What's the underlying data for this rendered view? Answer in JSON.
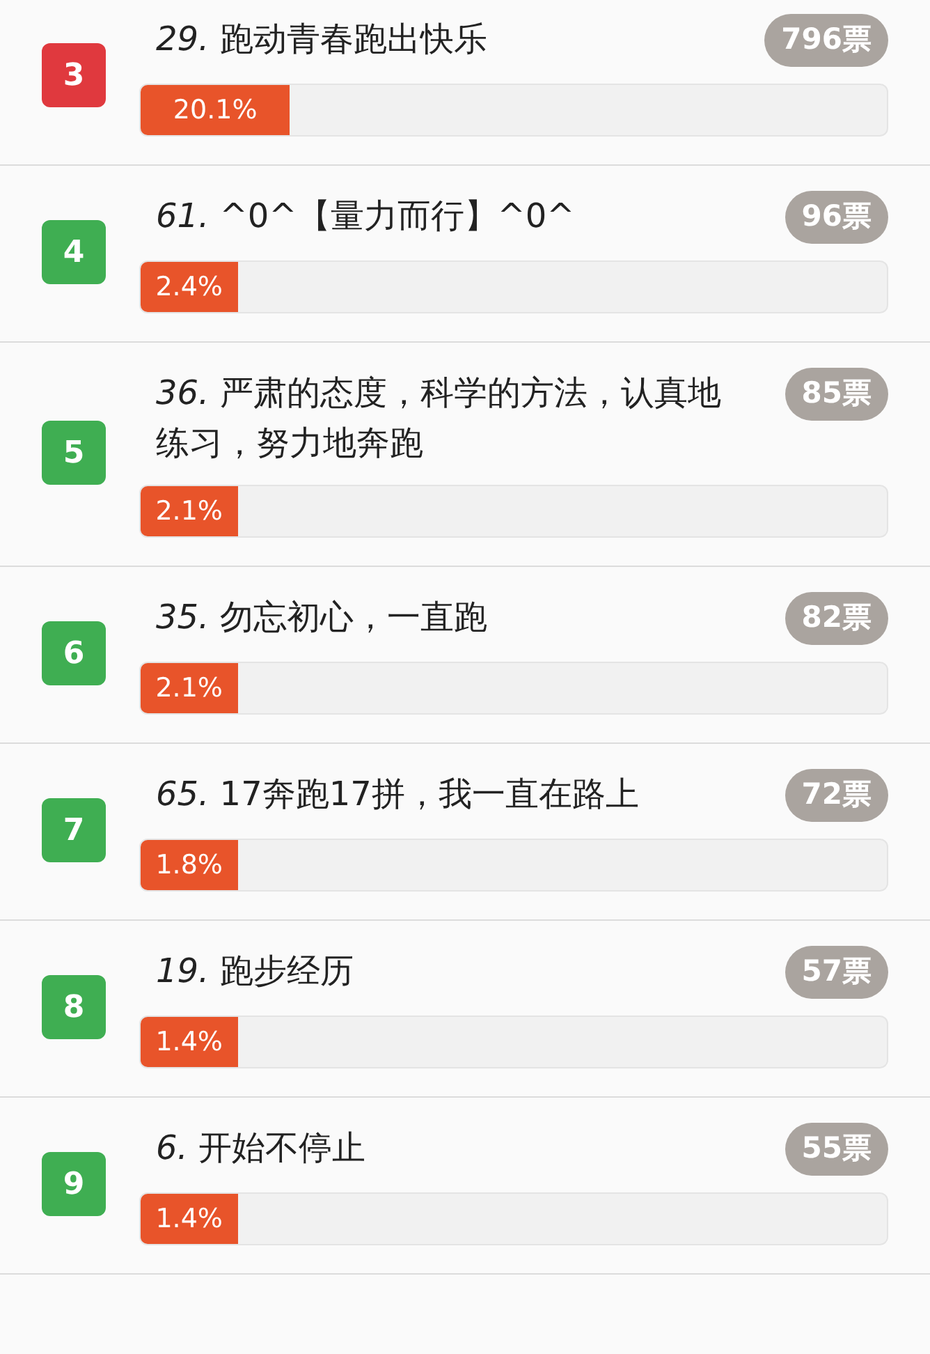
{
  "entries": [
    {
      "rank": "3",
      "color": "#e0393e",
      "title": "*29.* 跑动青春跑出快乐",
      "votes": "796票",
      "percent": "20.1%",
      "level": 0.2
    },
    {
      "rank": "4",
      "color": "#3fae52",
      "title": "*61.* ^0^【量力而行】^0^",
      "votes": "96票",
      "percent": "2.4%",
      "level": 0.13
    },
    {
      "rank": "5",
      "color": "#3fae52",
      "title": "*36.* 严肃的态度，科学的方法，认真地练习，努力地奔跑",
      "votes": "85票",
      "percent": "2.1%",
      "level": 0.13
    },
    {
      "rank": "6",
      "color": "#3fae52",
      "title": "*35.* 勿忘初心，一直跑",
      "votes": "82票",
      "percent": "2.1%",
      "level": 0.13
    },
    {
      "rank": "7",
      "color": "#3fae52",
      "title": "*65.* 17奔跑17拼，我一直在路上",
      "votes": "72票",
      "percent": "1.8%",
      "level": 0.13
    },
    {
      "rank": "8",
      "color": "#3fae52",
      "title": "*19.* 跑步经历",
      "votes": "57票",
      "percent": "1.4%",
      "level": 0.13
    },
    {
      "rank": "9",
      "color": "#3fae52",
      "title": "*6.* 开始不停止",
      "votes": "55票",
      "percent": "1.4%",
      "level": 0.13
    }
  ]
}
